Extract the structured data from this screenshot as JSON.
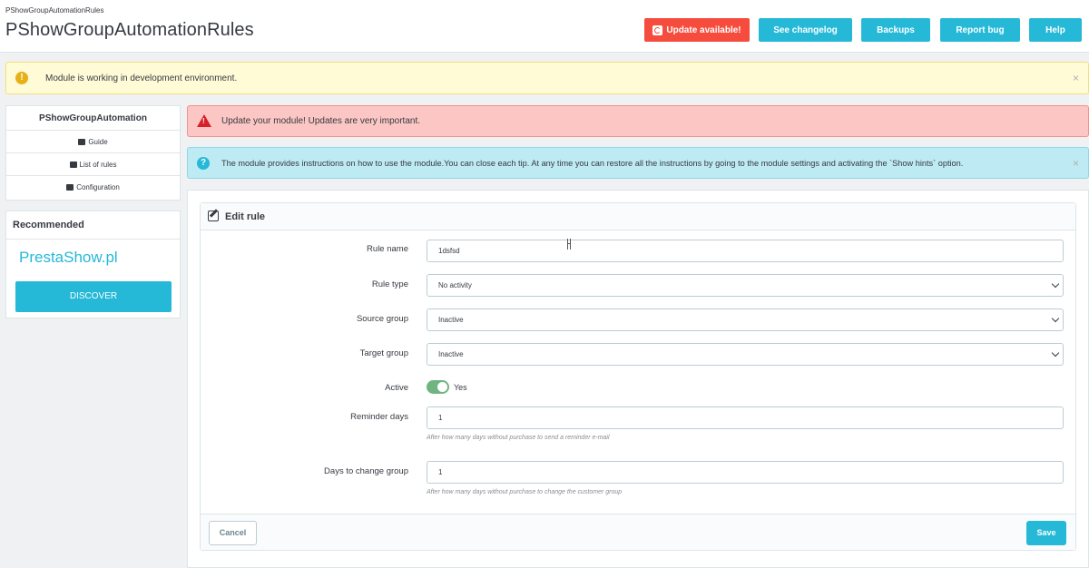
{
  "header": {
    "breadcrumb": "PShowGroupAutomationRules",
    "title": "PShowGroupAutomationRules",
    "buttons": {
      "update": "Update available!",
      "changelog": "See changelog",
      "backups": "Backups",
      "report_bug": "Report bug",
      "help": "Help"
    }
  },
  "alerts": {
    "dev_env": "Module is working in development environment.",
    "update": "Update your module! Updates are very important.",
    "info": "The module provides instructions on how to use the module.You can close each tip. At any time you can restore all the instructions by going to the module settings and activating the `Show hints` option.",
    "close_glyph": "×"
  },
  "sidebar": {
    "title": "PShowGroupAutomation",
    "items": [
      {
        "label": "Guide",
        "icon": "book-icon"
      },
      {
        "label": "List of rules",
        "icon": "list-icon"
      },
      {
        "label": "Configuration",
        "icon": "gears-icon"
      }
    ],
    "recommended": {
      "title": "Recommended",
      "brand": "PrestaShow.pl",
      "button": "DISCOVER"
    }
  },
  "form": {
    "title": "Edit rule",
    "fields": {
      "rule_name": {
        "label": "Rule name",
        "value": "1dsfsd"
      },
      "rule_type": {
        "label": "Rule type",
        "value": "No activity"
      },
      "source_group": {
        "label": "Source group",
        "value": "Inactive"
      },
      "target_group": {
        "label": "Target group",
        "value": "Inactive"
      },
      "active": {
        "label": "Active",
        "value": "Yes",
        "on": true
      },
      "reminder_days": {
        "label": "Reminder days",
        "value": "1",
        "help": "After how many days without purchase to send a reminder e-mail"
      },
      "days_to_change": {
        "label": "Days to change group",
        "value": "1",
        "help": "After how many days without purchase to change the customer group"
      }
    },
    "cancel": "Cancel",
    "save": "Save"
  },
  "colors": {
    "primary": "#25b9d7",
    "danger": "#f54c3e",
    "toggle_on": "#70b580"
  }
}
